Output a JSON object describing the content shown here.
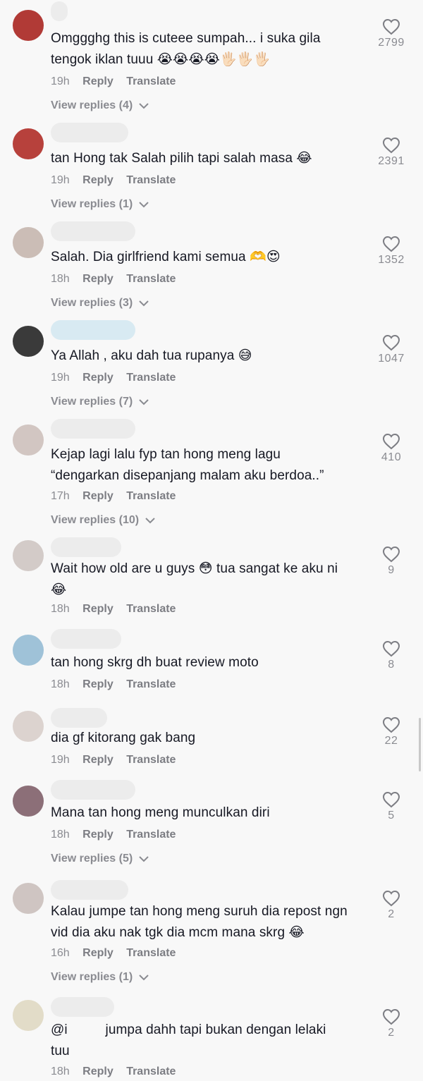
{
  "comments": [
    {
      "text": "Omggghg this is cuteee sumpah... i suka gila\ntengok iklan tuuu 😭😭😭😭🖐🏻🖐🏻🖐🏻",
      "time": "19h",
      "reply": "Reply",
      "translate": "Translate",
      "replies": "View replies (4)",
      "likes": "2799"
    },
    {
      "text": "tan Hong tak Salah pilih tapi salah masa 😂",
      "time": "19h",
      "reply": "Reply",
      "translate": "Translate",
      "replies": "View replies (1)",
      "likes": "2391"
    },
    {
      "text": "Salah. Dia girlfriend kami semua 🫶😍",
      "time": "18h",
      "reply": "Reply",
      "translate": "Translate",
      "replies": "View replies (3)",
      "likes": "1352"
    },
    {
      "text": "Ya Allah , aku dah tua rupanya 😅",
      "time": "19h",
      "reply": "Reply",
      "translate": "Translate",
      "replies": "View replies (7)",
      "likes": "1047"
    },
    {
      "text": "Kejap lagi lalu fyp tan hong meng lagu\n“dengarkan disepanjang malam aku berdoa..”",
      "time": "17h",
      "reply": "Reply",
      "translate": "Translate",
      "replies": "View replies (10)",
      "likes": "410"
    },
    {
      "text": "Wait how old are u guys 😳 tua sangat ke aku ni\n😂",
      "time": "18h",
      "reply": "Reply",
      "translate": "Translate",
      "replies": "",
      "likes": "9"
    },
    {
      "text": "tan hong skrg dh buat review moto",
      "time": "18h",
      "reply": "Reply",
      "translate": "Translate",
      "replies": "",
      "likes": "8"
    },
    {
      "text": "dia gf kitorang gak bang",
      "time": "19h",
      "reply": "Reply",
      "translate": "Translate",
      "replies": "",
      "likes": "22"
    },
    {
      "text": "Mana tan hong meng munculkan diri",
      "time": "18h",
      "reply": "Reply",
      "translate": "Translate",
      "replies": "View replies (5)",
      "likes": "5"
    },
    {
      "text": "Kalau jumpe tan hong meng suruh dia repost ngn\nvid dia aku nak tgk dia mcm mana skrg 😂",
      "time": "16h",
      "reply": "Reply",
      "translate": "Translate",
      "replies": "View replies (1)",
      "likes": "2"
    },
    {
      "text": "@i          jumpa dahh tapi bukan dengan lelaki\ntuu",
      "time": "18h",
      "reply": "Reply",
      "translate": "Translate",
      "replies": "",
      "likes": "2"
    }
  ],
  "icons": {
    "like": "heart-outline-icon",
    "expand": "chevron-down-icon"
  },
  "colors": {
    "background": "#f8f8f8",
    "text": "#161823",
    "secondary": "#8a8b91"
  }
}
